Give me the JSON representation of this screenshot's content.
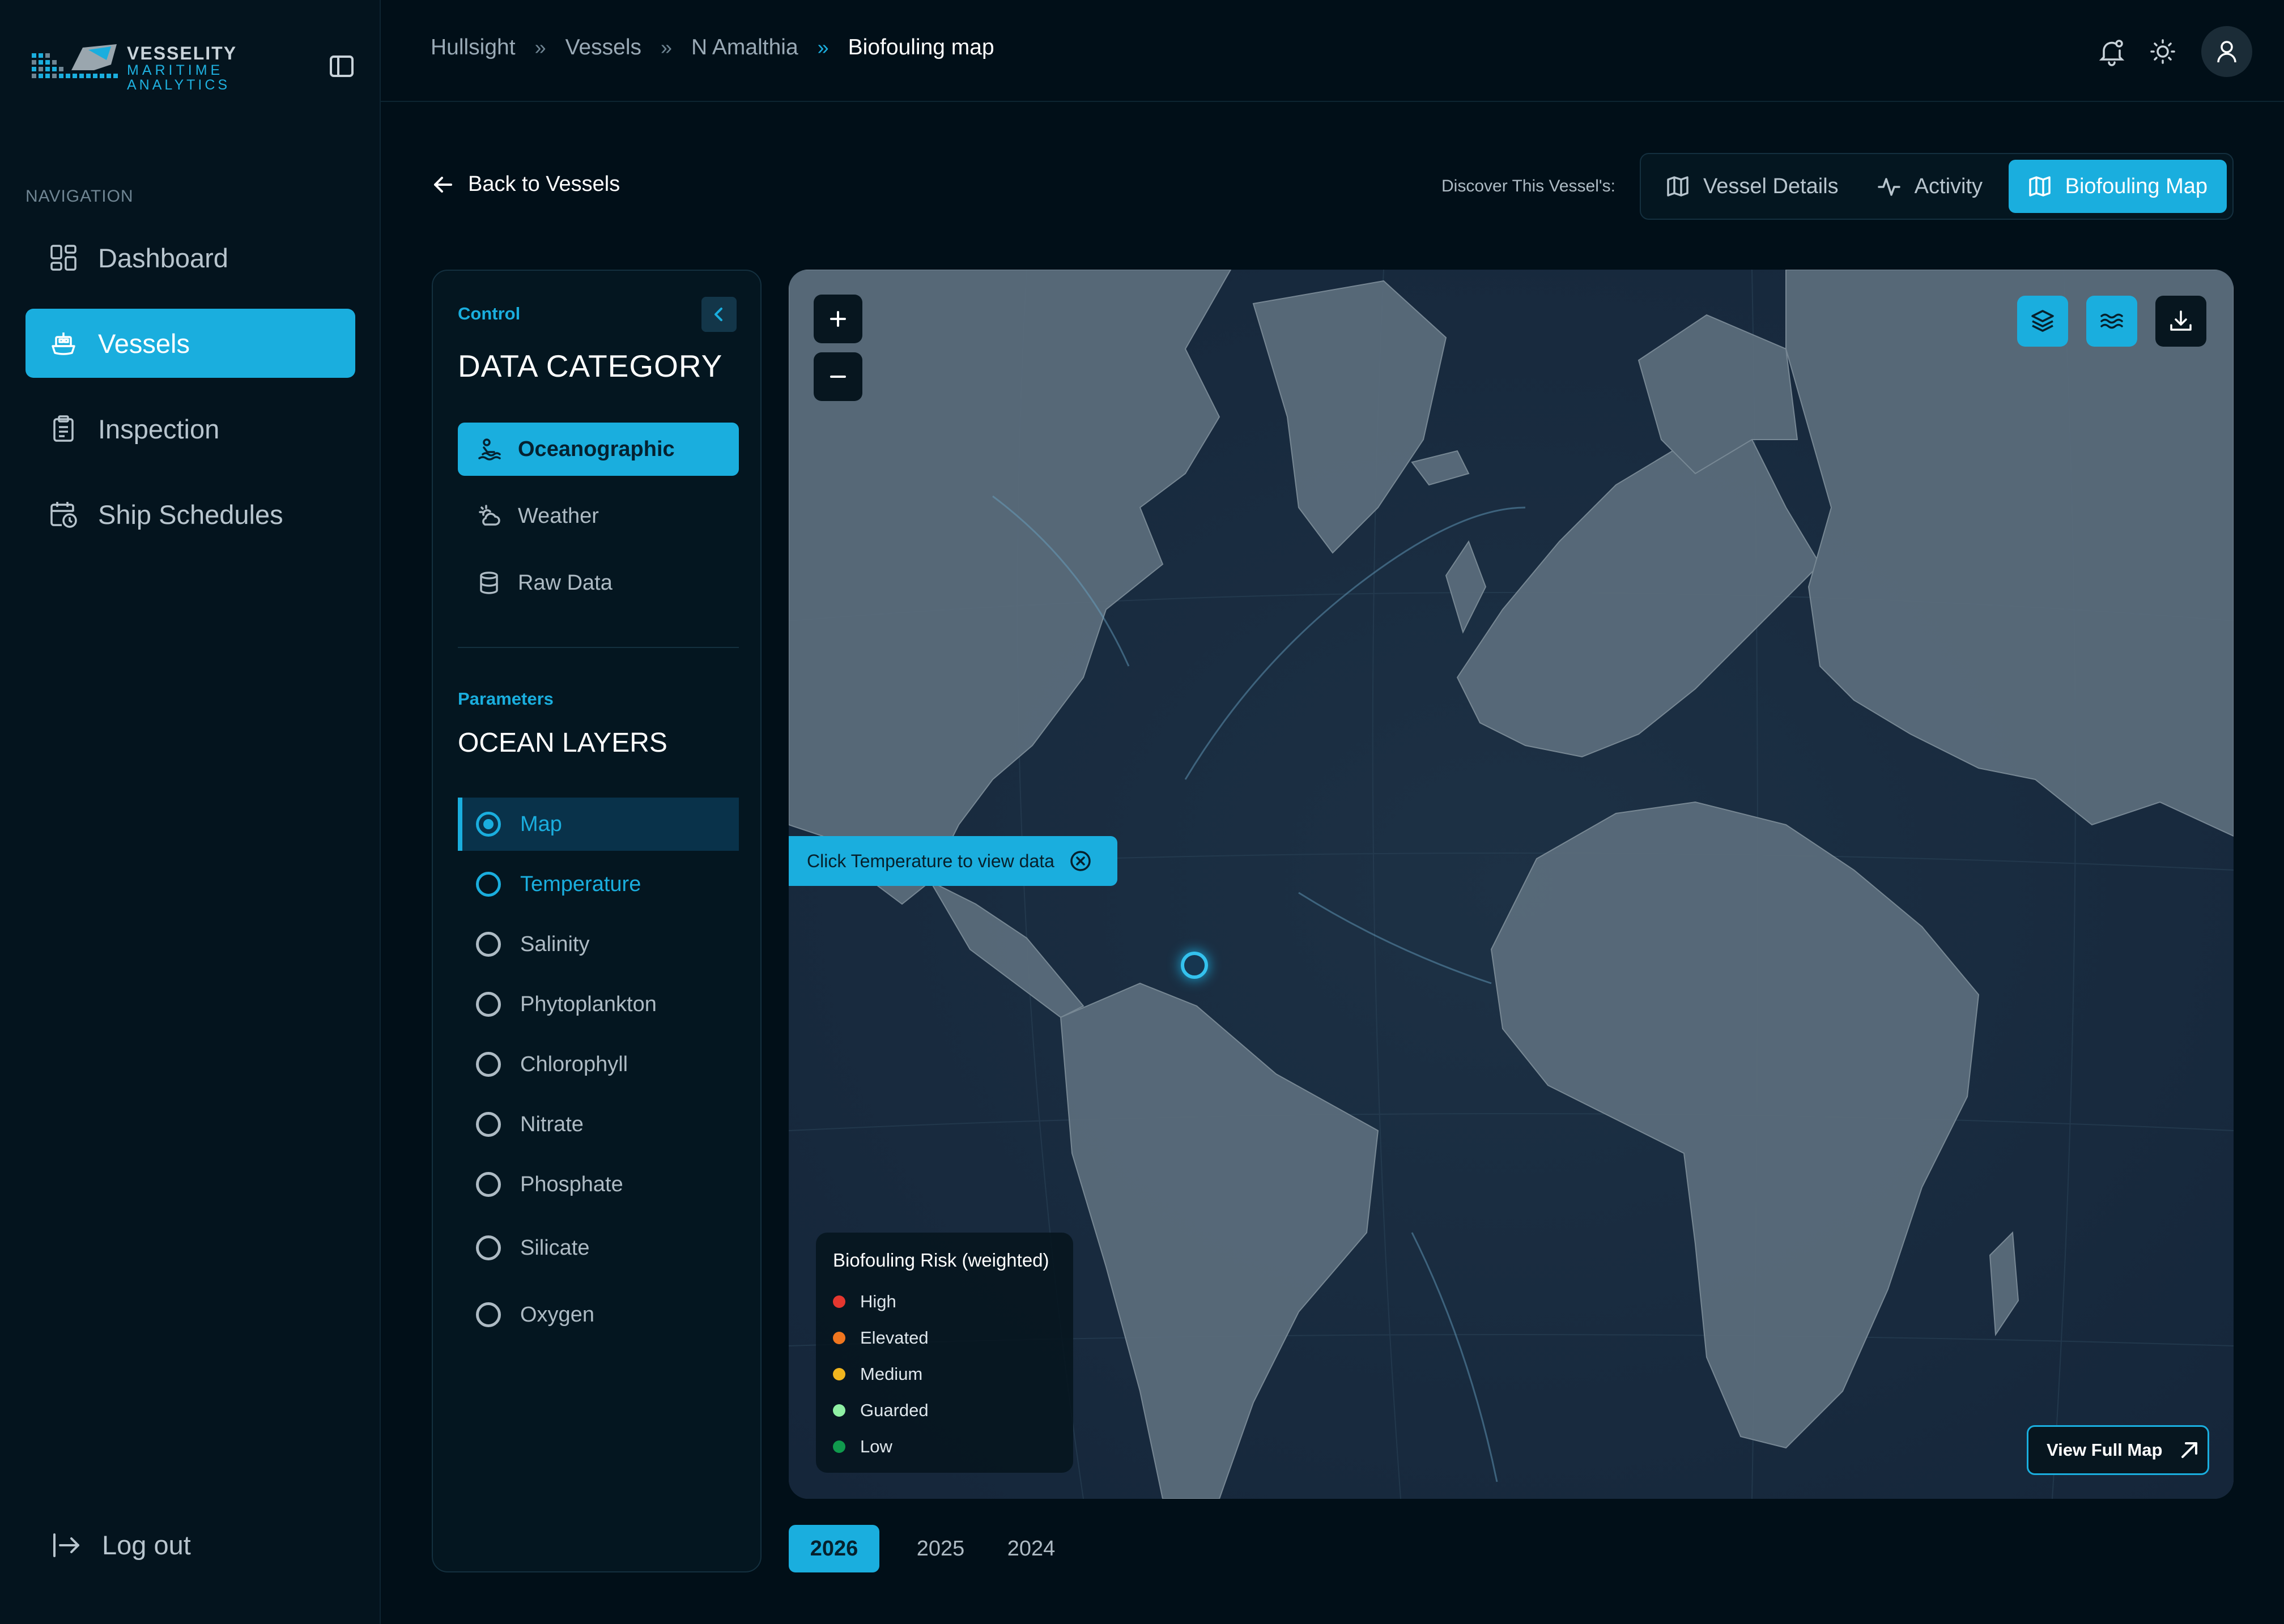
{
  "brand": {
    "line1": "VESSELITY",
    "line2": "MARITIME",
    "line3": "ANALYTICS"
  },
  "nav": {
    "heading": "NAVIGATION",
    "items": [
      {
        "label": "Dashboard",
        "icon": "dashboard-icon",
        "active": false
      },
      {
        "label": "Vessels",
        "icon": "ship-icon",
        "active": true
      },
      {
        "label": "Inspection",
        "icon": "clipboard-icon",
        "active": false
      },
      {
        "label": "Ship Schedules",
        "icon": "calendar-clock-icon",
        "active": false
      }
    ],
    "logout": "Log out"
  },
  "breadcrumb": [
    "Hullsight",
    "Vessels",
    "N Amalthia",
    "Biofouling map"
  ],
  "subheader": {
    "back": "Back to Vessels",
    "discover": "Discover This Vessel's:",
    "tabs": [
      "Vessel Details",
      "Activity",
      "Biofouling Map"
    ],
    "active_tab": "Biofouling Map"
  },
  "control": {
    "eyebrow": "Control",
    "title": "DATA CATEGORY",
    "categories": [
      "Oceanographic",
      "Weather",
      "Raw Data"
    ],
    "active_category": "Oceanographic",
    "params_eyebrow": "Parameters",
    "params_title": "OCEAN LAYERS",
    "layers": [
      "Map",
      "Temperature",
      "Salinity",
      "Phytoplankton",
      "Chlorophyll",
      "Nitrate",
      "Phosphate",
      "Silicate",
      "Oxygen"
    ],
    "selected_layer": "Map"
  },
  "map": {
    "tooltip": "Click Temperature to view data",
    "legend_title": "Biofouling Risk (weighted)",
    "legend": [
      {
        "label": "High",
        "color": "#e5372f"
      },
      {
        "label": "Elevated",
        "color": "#f0761f"
      },
      {
        "label": "Medium",
        "color": "#f1b51e"
      },
      {
        "label": "Guarded",
        "color": "#8ff0a4"
      },
      {
        "label": "Low",
        "color": "#109a4d"
      }
    ],
    "view_full": "View Full Map"
  },
  "years": [
    "2026",
    "2025",
    "2024"
  ],
  "active_year": "2026",
  "colors": {
    "accent": "#1aaede",
    "background": "#010f18",
    "panel": "#041620"
  }
}
